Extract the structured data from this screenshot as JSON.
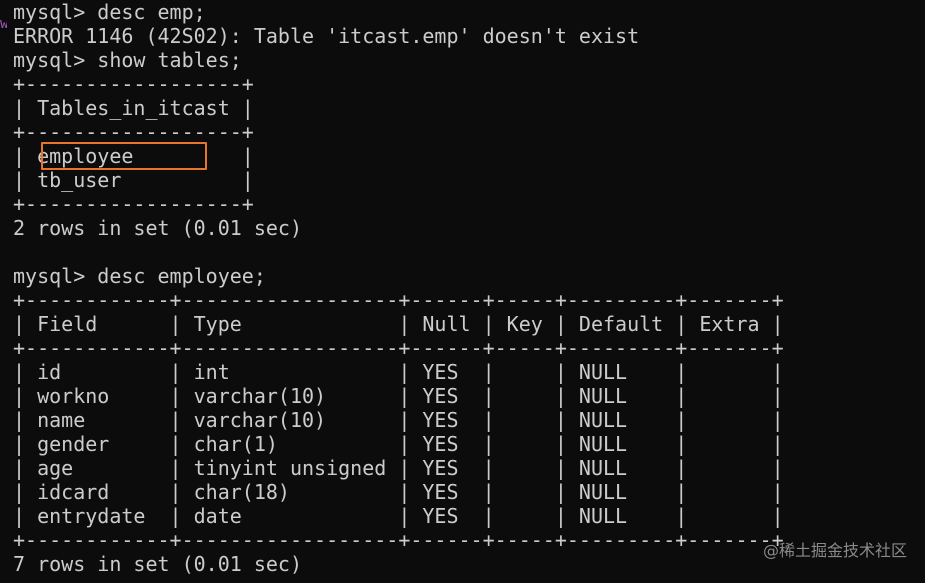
{
  "terminal": {
    "lines": [
      "mysql> desc emp;",
      "ERROR 1146 (42S02): Table 'itcast.emp' doesn't exist",
      "mysql> show tables;",
      "+------------------+",
      "| Tables_in_itcast |",
      "+------------------+",
      "| employee         |",
      "| tb_user          |",
      "+------------------+",
      "2 rows in set (0.01 sec)",
      "",
      "mysql> desc employee;",
      "+------------+------------------+------+-----+---------+-------+",
      "| Field      | Type             | Null | Key | Default | Extra |",
      "+------------+------------------+------+-----+---------+-------+",
      "| id         | int              | YES  |     | NULL    |       |",
      "| workno     | varchar(10)      | YES  |     | NULL    |       |",
      "| name       | varchar(10)      | YES  |     | NULL    |       |",
      "| gender     | char(1)          | YES  |     | NULL    |       |",
      "| age        | tinyint unsigned | YES  |     | NULL    |       |",
      "| idcard     | char(18)         | YES  |     | NULL    |       |",
      "| entrydate  | date             | YES  |     | NULL    |       |",
      "+------------+------------------+------+-----+---------+-------+",
      "7 rows in set (0.01 sec)"
    ]
  },
  "left_marker": "w",
  "watermark": "@稀土掘金技术社区",
  "colors": {
    "background": "#0c0c0c",
    "text": "#cccccc",
    "highlight": "#e8742c"
  }
}
